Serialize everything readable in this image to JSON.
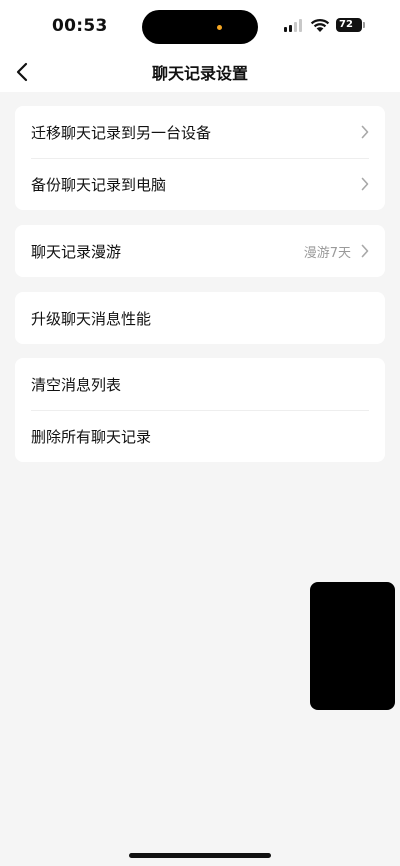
{
  "status_bar": {
    "time": "00:53",
    "battery": "72"
  },
  "header": {
    "title": "聊天记录设置",
    "back_icon": "chevron-left-icon"
  },
  "groups": [
    {
      "items": [
        {
          "label": "迁移聊天记录到另一台设备",
          "value": "",
          "chevron": true
        },
        {
          "label": "备份聊天记录到电脑",
          "value": "",
          "chevron": true
        }
      ]
    },
    {
      "items": [
        {
          "label": "聊天记录漫游",
          "value": "漫游7天",
          "chevron": true
        }
      ]
    },
    {
      "items": [
        {
          "label": "升级聊天消息性能",
          "value": "",
          "chevron": false
        }
      ]
    },
    {
      "items": [
        {
          "label": "清空消息列表",
          "value": "",
          "chevron": false
        },
        {
          "label": "删除所有聊天记录",
          "value": "",
          "chevron": false
        }
      ]
    }
  ],
  "colors": {
    "background": "#f5f5f5",
    "card": "#ffffff",
    "secondary_text": "#9a9a9a",
    "island_dot": "#f5a623"
  }
}
